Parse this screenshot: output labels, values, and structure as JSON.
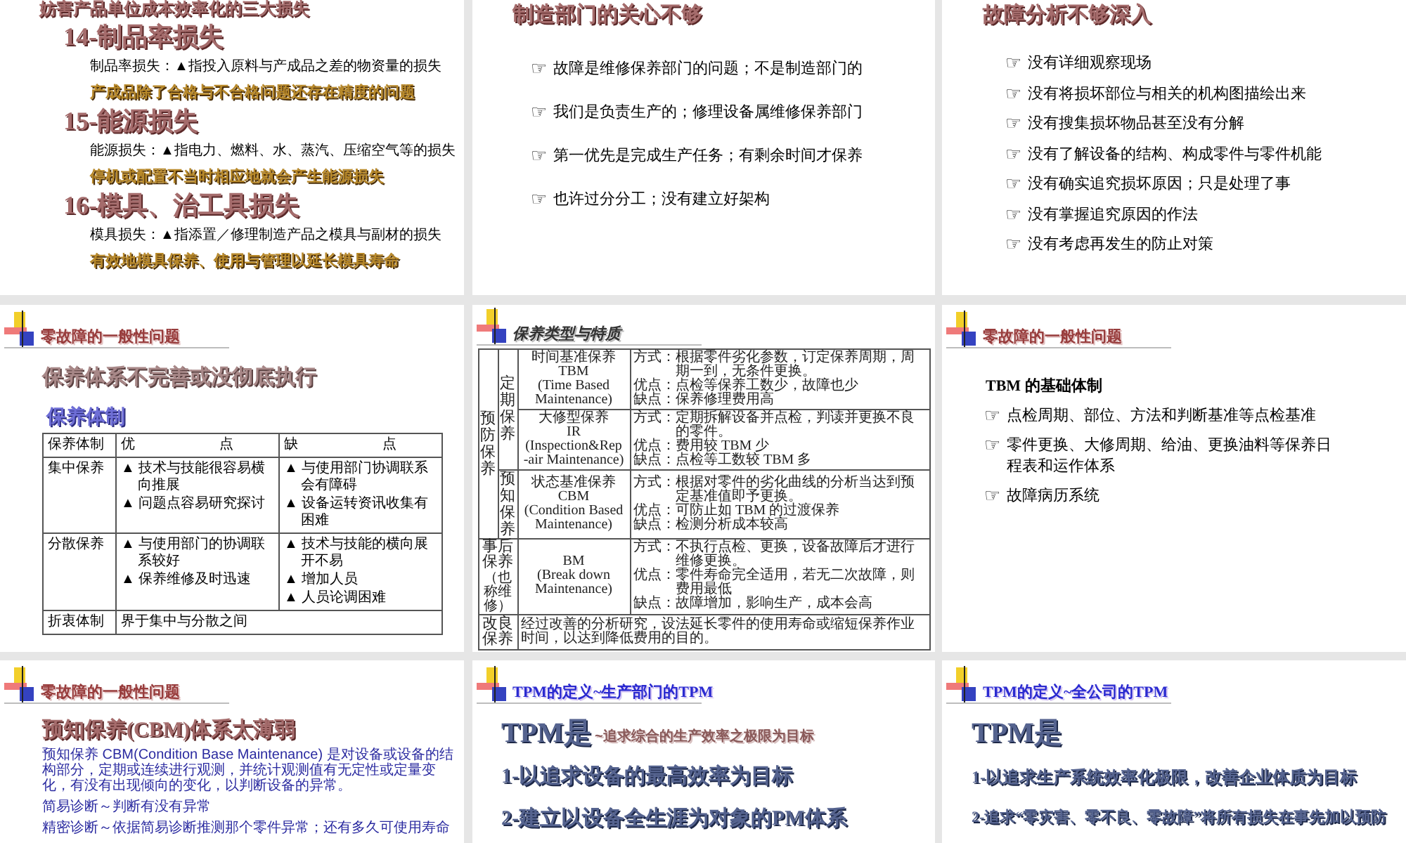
{
  "slides": [
    {
      "kind": "losses",
      "heading": "妨害产品单位成本效率化的三大损失",
      "losses": [
        {
          "title": "14-制品率损失",
          "definition": "制品率损失：▲指投入原料与产成品之差的物资量的损失",
          "highlight": "产成品除了合格与不合格问题还存在精度的问题"
        },
        {
          "title": "15-能源损失",
          "definition": "能源损失：▲指电力、燃料、水、蒸汽、压缩空气等的损失",
          "highlight": "停机或配置不当时相应地就会产生能源损失"
        },
        {
          "title": "16-模具、治工具损失",
          "definition": "模具损失：▲指添置／修理制造产品之模具与副材的损失",
          "highlight": "有效地模具保养、使用与管理以延长模具寿命"
        }
      ]
    },
    {
      "kind": "bullets",
      "title": "制造部门的关心不够",
      "items": [
        {
          "marker": "☞",
          "text": "故障是维修保养部门的问题；不是制造部门的"
        },
        {
          "marker": "☞",
          "text": "我们是负责生产的；修理设备属维修保养部门"
        },
        {
          "marker": "☞",
          "text": "第一优先是完成生产任务；有剩余时间才保养"
        },
        {
          "marker": "☞",
          "text": "也许过分分工；没有建立好架构"
        }
      ]
    },
    {
      "kind": "bullets",
      "title": "故障分析不够深入",
      "items": [
        {
          "marker": "☞",
          "text": "没有详细观察现场"
        },
        {
          "marker": "☞",
          "text": "没有将损坏部位与相关的机构图描绘出来"
        },
        {
          "marker": "☞",
          "text": "没有搜集损坏物品甚至没有分解"
        },
        {
          "marker": "☞",
          "text": "没有了解设备的结构、构成零件与零件机能"
        },
        {
          "marker": "☞",
          "text": "没有确实追究损坏原因；只是处理了事"
        },
        {
          "marker": "☞",
          "text": "没有掌握追究原因的作法"
        },
        {
          "marker": "☞",
          "text": "没有考虑再发生的防止对策"
        }
      ]
    },
    {
      "kind": "system_table",
      "header": "零故障的一般性问题",
      "title": "保养体系不完善或没彻底执行",
      "subtitle": "保养体制",
      "table": {
        "columns": [
          "保养体制",
          "优　　　　　　点",
          "缺　　　　　　点"
        ],
        "rows": [
          {
            "name": "集中保养",
            "pros": [
              "▲ 技术与技能很容易横向推展",
              "▲ 问题点容易研究探讨"
            ],
            "cons": [
              "▲ 与使用部门协调联系会有障碍",
              "▲ 设备运转资讯收集有困难"
            ]
          },
          {
            "name": "分散保养",
            "pros": [
              "▲ 与使用部门的协调联系较好",
              "▲ 保养维修及时迅速"
            ],
            "cons": [
              "▲ 技术与技能的横向展开不易",
              "▲ 增加人员",
              "▲ 人员论调困难"
            ]
          }
        ],
        "footer": {
          "name": "折衷体制",
          "text": "界于集中与分散之间"
        }
      }
    },
    {
      "kind": "type_table",
      "header": "保养类型与特质",
      "table": {
        "groups": [
          {
            "label": "预防保养",
            "subgroups": [
              {
                "label": "定期保养",
                "types": [
                  {
                    "name": [
                      "时间基准保养",
                      "TBM",
                      "(Time Based",
                      "Maintenance)"
                    ],
                    "notes": [
                      "方式：根据零件劣化参数，订定保养周期，周期一到，无条件更换。",
                      "优点：点检等保养工数少，故障也少",
                      "缺点：保养修理费用高"
                    ]
                  },
                  {
                    "name": [
                      "大修型保养",
                      "IR",
                      "(Inspection&Rep",
                      "-air Maintenance)"
                    ],
                    "notes": [
                      "方式：定期拆解设备并点检，判读并更换不良的零件。",
                      "优点：费用较 TBM 少",
                      "缺点：点检等工数较 TBM 多"
                    ]
                  }
                ]
              },
              {
                "label": "预知保养",
                "types": [
                  {
                    "name": [
                      "状态基准保养",
                      "CBM",
                      "(Condition Based",
                      "Maintenance)"
                    ],
                    "notes": [
                      "方式：根据对零件的劣化曲线的分析当达到预定基准值即予更换。",
                      "优点：可防止如 TBM 的过渡保养",
                      "缺点：检测分析成本较高"
                    ]
                  }
                ]
              }
            ]
          },
          {
            "label": "事后保养",
            "note": "（也称维修）",
            "types": [
              {
                "name": [
                  "BM",
                  "(Break down",
                  "Maintenance)"
                ],
                "notes": [
                  "方式：不执行点检、更换，设备故障后才进行维修更换。",
                  "优点：零件寿命完全适用，若无二次故障，则费用最低",
                  "缺点：故障增加，影响生产，成本会高"
                ]
              }
            ]
          },
          {
            "label": "改良保养",
            "description": "经过改善的分析研究，设法延长零件的使用寿命或缩短保养作业时间，以达到降低费用的目的。"
          }
        ]
      }
    },
    {
      "kind": "basics",
      "header": "零故障的一般性问题",
      "lead": "TBM 的基础体制",
      "items": [
        {
          "marker": "☞",
          "text": "点检周期、部位、方法和判断基准等点检基准"
        },
        {
          "marker": "☞",
          "text": "零件更换、大修周期、给油、更换油料等保养日程表和运作体系"
        },
        {
          "marker": "☞",
          "text": "故障病历系统"
        }
      ]
    },
    {
      "kind": "cbm",
      "header": "零故障的一般性问题",
      "title": "预知保养(CBM)体系太薄弱",
      "paragraphs": [
        "预知保养 CBM(Condition Base Maintenance) 是对设备或设备的结构部分，定期或连续进行观测，并统计观测值有无定性或定量变化，有没有出现倾向的变化，以判断设备的异常。",
        "简易诊断～判断有没有异常",
        "精密诊断～依据简易诊断推测那个零件异常；还有多久可使用寿命"
      ]
    },
    {
      "kind": "tpm",
      "header": "TPM的定义~生产部门的TPM",
      "title": "TPM是",
      "title_note": "~追求综合的生产效率之极限为目标",
      "points": [
        "1-以追求设备的最高效率为目标",
        "2-建立以设备全生涯为对象的PM体系"
      ]
    },
    {
      "kind": "tpm",
      "header": "TPM的定义~全公司的TPM",
      "title": "TPM是",
      "points": [
        "1-以追求生产系统效率化极限，改善企业体质为目标",
        "2-追求“零灾害、零不良、零故障”将所有损失在事先加以预防"
      ]
    }
  ]
}
